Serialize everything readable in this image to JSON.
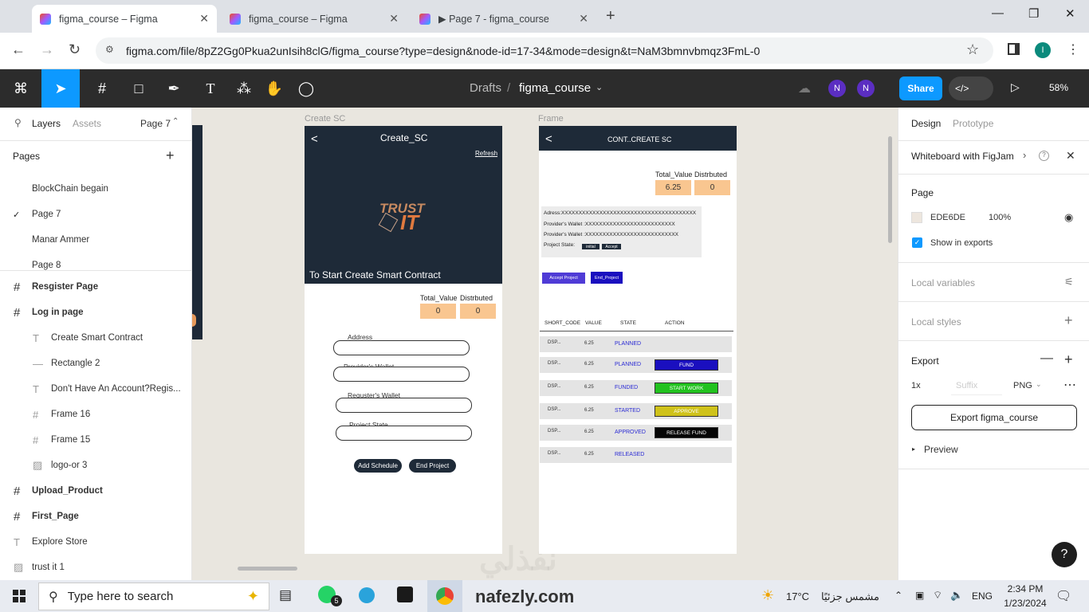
{
  "browser": {
    "tabs": [
      {
        "title": "figma_course – Figma"
      },
      {
        "title": "figma_course – Figma"
      },
      {
        "title": "▶ Page 7 - figma_course"
      }
    ],
    "url": "figma.com/file/8pZ2Gg0Pkua2unIsih8clG/figma_course?type=design&node-id=17-34&mode=design&t=NaM3bmnvbmqz3FmL-0",
    "profile_initial": "I"
  },
  "toolbar": {
    "breadcrumb_root": "Drafts",
    "separator": "/",
    "file_name": "figma_course",
    "avatars": [
      "N",
      "N"
    ],
    "share_label": "Share",
    "zoom": "58%"
  },
  "left_panel": {
    "tabs": {
      "layers": "Layers",
      "assets": "Assets",
      "page": "Page 7"
    },
    "pages_heading": "Pages",
    "pages": [
      "BlockChain begain",
      "Page 7",
      "Manar Ammer",
      "Page 8"
    ],
    "current_page": "Page 7",
    "layers": [
      {
        "label": "Resgister Page",
        "icon": "frame-icon",
        "bold": true,
        "indent": false
      },
      {
        "label": "Log in page",
        "icon": "frame-icon",
        "bold": true,
        "indent": false
      },
      {
        "label": "Create Smart Contract",
        "icon": "text-icon",
        "bold": false,
        "indent": true
      },
      {
        "label": "Rectangle 2",
        "icon": "rectangle-icon",
        "bold": false,
        "indent": true
      },
      {
        "label": "Don't Have An Account?Regis...",
        "icon": "text-icon",
        "bold": false,
        "indent": true
      },
      {
        "label": "Frame 16",
        "icon": "frame-icon",
        "bold": false,
        "indent": true
      },
      {
        "label": "Frame 15",
        "icon": "frame-icon",
        "bold": false,
        "indent": true
      },
      {
        "label": "logo-or 3",
        "icon": "image-icon",
        "bold": false,
        "indent": true
      },
      {
        "label": "Upload_Product",
        "icon": "frame-icon",
        "bold": true,
        "indent": false
      },
      {
        "label": "First_Page",
        "icon": "frame-icon",
        "bold": true,
        "indent": false
      },
      {
        "label": "Explore Store",
        "icon": "text-icon",
        "bold": false,
        "indent": false
      },
      {
        "label": "trust it 1",
        "icon": "image-icon",
        "bold": false,
        "indent": false
      }
    ]
  },
  "canvas": {
    "frame1": {
      "label": "Create SC",
      "title": "Create_SC",
      "back": "<",
      "refresh": "Refresh",
      "logo_top": "TRUST",
      "logo_bottom": "IT",
      "banner_text": "To Start Create Smart Contract",
      "total_label": "Total_Value",
      "distributed_label": "Distrbuted",
      "total_value": "0",
      "distributed_value": "0",
      "fields": [
        "Address",
        "Provider's Wallet",
        "Requster's Wallet",
        "Proiect State"
      ],
      "btn_add": "Add Schedule",
      "btn_end": "End Project"
    },
    "frame2": {
      "label": "Frame",
      "title": "CONT..CREATE SC",
      "back": "<",
      "total_label": "Total_Value",
      "distributed_label": "Distrbuted",
      "total_value": "6.25",
      "distributed_value": "0",
      "info_address": "Adress:XXXXXXXXXXXXXXXXXXXXXXXXXXXXXXXXXXXXXXX",
      "info_provider": "Provider's Wallet :XXXXXXXXXXXXXXXXXXXXXXXXXX",
      "info_provider2": "Provider's Wallet :XXXXXXXXXXXXXXXXXXXXXXXXXXX",
      "info_state": "Project State:",
      "state_tag1": "initial",
      "state_tag2": "Accept",
      "btn_accept": "Accept Project",
      "btn_end": "End_Project",
      "headers": [
        "SHORT_CODE",
        "VALUE",
        "STATE",
        "ACTION"
      ],
      "rows": [
        {
          "code": "DSP...",
          "value": "6.25",
          "state": "PLANNED",
          "action": "",
          "action_color": ""
        },
        {
          "code": "DSP...",
          "value": "6.25",
          "state": "PLANNED",
          "action": "FUND",
          "action_color": "#1a0fbf"
        },
        {
          "code": "DSP...",
          "value": "6.25",
          "state": "FUNDED",
          "action": "START WORK",
          "action_color": "#22c21f"
        },
        {
          "code": "DSP...",
          "value": "6.25",
          "state": "STARTED",
          "action": "APPROVE",
          "action_color": "#cfc21a"
        },
        {
          "code": "DSP...",
          "value": "6.25",
          "state": "APPROVED",
          "action": "RELEASE FUND",
          "action_color": "#050505"
        },
        {
          "code": "DSP...",
          "value": "6.25",
          "state": "RELEASED",
          "action": "",
          "action_color": ""
        }
      ]
    },
    "watermark": "نفذلي"
  },
  "right_panel": {
    "tabs": {
      "design": "Design",
      "prototype": "Prototype"
    },
    "whiteboard": "Whiteboard with FigJam",
    "page_heading": "Page",
    "page_color": "EDE6DE",
    "page_opacity": "100%",
    "show_in_exports": "Show in exports",
    "local_variables": "Local variables",
    "local_styles": "Local styles",
    "export_heading": "Export",
    "export_scale": "1x",
    "export_suffix_placeholder": "Suffix",
    "export_format": "PNG",
    "export_button": "Export figma_course",
    "preview": "Preview",
    "help": "?"
  },
  "taskbar": {
    "search_placeholder": "Type here to search",
    "whatsapp_badge": "5",
    "watermark_site": "nafezly.com",
    "weather_temp": "17°C",
    "weather_desc": "مشمس جزئيًا",
    "language": "ENG",
    "time": "2:34 PM",
    "date": "1/23/2024"
  },
  "colors": {
    "figma_dark": "#2c2c2c",
    "accent_blue": "#0d99ff",
    "frame_dark": "#1e2a38",
    "value_orange": "#f9c690",
    "avatar_purple": "#5b2ec2"
  }
}
